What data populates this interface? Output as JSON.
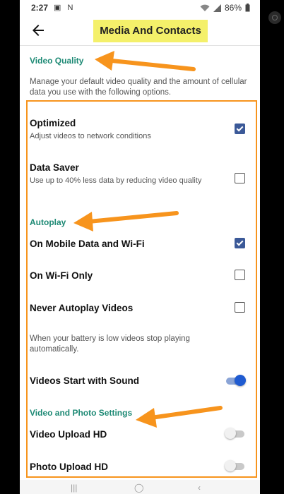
{
  "status_bar": {
    "time": "2:27",
    "notification_icons": "▣ N",
    "battery_percent": "86%",
    "signal_icons": [
      "wifi-icon",
      "signal-icon",
      "battery-icon"
    ]
  },
  "header": {
    "title": "Media And Contacts",
    "back_icon": "arrow-left-icon",
    "highlight_color": "#f4f06a"
  },
  "video_quality": {
    "title": "Video Quality",
    "description": "Manage your default video quality and the amount of cellular data you use with the following options.",
    "options": [
      {
        "title": "Optimized",
        "subtitle": "Adjust videos to network conditions",
        "checked": true
      },
      {
        "title": "Data Saver",
        "subtitle": "Use up to 40% less data by reducing video quality",
        "checked": false
      }
    ]
  },
  "autoplay": {
    "title": "Autoplay",
    "options": [
      {
        "title": "On Mobile Data and Wi-Fi",
        "checked": true
      },
      {
        "title": "On Wi-Fi Only",
        "checked": false
      },
      {
        "title": "Never Autoplay Videos",
        "checked": false
      }
    ],
    "note": "When your battery is low videos stop playing automatically.",
    "sound": {
      "title": "Videos Start with Sound",
      "enabled": true
    }
  },
  "video_photo_settings": {
    "title": "Video and Photo Settings",
    "items": [
      {
        "title": "Video Upload HD",
        "enabled": false
      },
      {
        "title": "Photo Upload HD",
        "enabled": false
      }
    ]
  },
  "nav_bar": {
    "recent": "|||",
    "home": "◯",
    "back": "‹"
  },
  "colors": {
    "section_title": "#1e8a75",
    "checkbox_checked": "#3b5998",
    "toggle_on": "#1f5bd1",
    "annotation_orange": "#f7941d"
  }
}
